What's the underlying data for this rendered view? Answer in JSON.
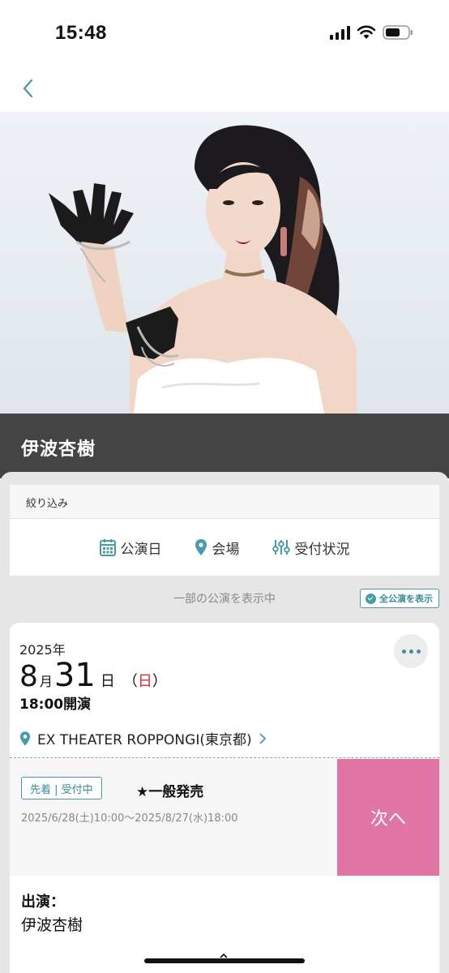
{
  "status_bar": {
    "time": "15:48"
  },
  "nav": {
    "back_icon": "chevron-left-icon"
  },
  "artist": {
    "name": "伊波杏樹"
  },
  "filter": {
    "heading": "絞り込み",
    "options": [
      {
        "label": "公演日",
        "icon": "calendar-icon"
      },
      {
        "label": "会場",
        "icon": "location-pin-icon"
      },
      {
        "label": "受付状況",
        "icon": "sliders-icon"
      }
    ]
  },
  "showing": {
    "text": "一部の公演を表示中",
    "show_all_label": "全公演を表示"
  },
  "event": {
    "year": "2025年",
    "month": "8",
    "month_unit": "月",
    "day": "31",
    "day_unit": "日",
    "weekday_open": "（",
    "weekday": "日",
    "weekday_close": "）",
    "time": "18:00開演",
    "venue": "EX THEATER ROPPONGI(東京都)",
    "sale_badge": "先着 | 受付中",
    "sale_title": "★一般発売",
    "sale_period": "2025/6/28(土)10:00～2025/8/27(水)18:00",
    "next_label": "次へ",
    "cast_label": "出演：",
    "cast_name": "伊波杏樹"
  },
  "colors": {
    "accent": "#4a9aa8",
    "next_button": "#e075a6",
    "title_band": "#444444",
    "weekday_red": "#d32f2f"
  }
}
